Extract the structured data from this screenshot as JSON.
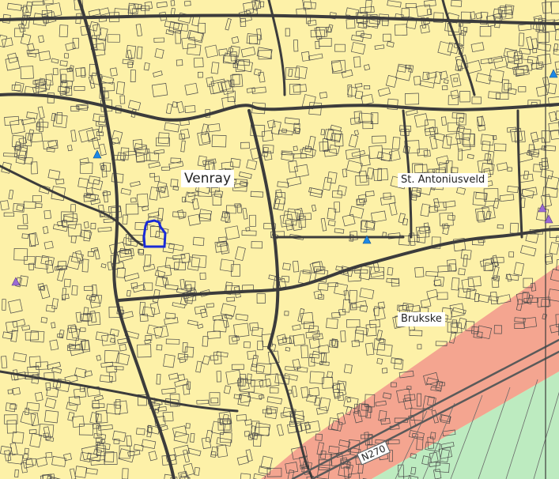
{
  "colors": {
    "built_area": "#fdf1a8",
    "industrial_zone": "#f4a590",
    "agricultural": "#bdebc0",
    "road": "#3c3c3c",
    "parcel": "#4a4a4a",
    "selected_parcel": "#1a2bd6",
    "poi_blue": "#1e88e5",
    "poi_purple": "#9b6bd3"
  },
  "labels": {
    "venray": "Venray",
    "antoniusveld": "St. Antoniusveld",
    "brukske": "Brukske",
    "n270": "N270"
  },
  "markers": [
    {
      "kind": "poi-blue",
      "icon": "triangle-blue-icon"
    },
    {
      "kind": "poi-blue",
      "icon": "triangle-blue-icon"
    },
    {
      "kind": "poi-blue",
      "icon": "triangle-blue-icon"
    },
    {
      "kind": "poi-purple",
      "icon": "triangle-purple-icon"
    },
    {
      "kind": "poi-purple",
      "icon": "triangle-purple-icon"
    },
    {
      "kind": "poi-purple",
      "icon": "triangle-purple-icon"
    }
  ]
}
